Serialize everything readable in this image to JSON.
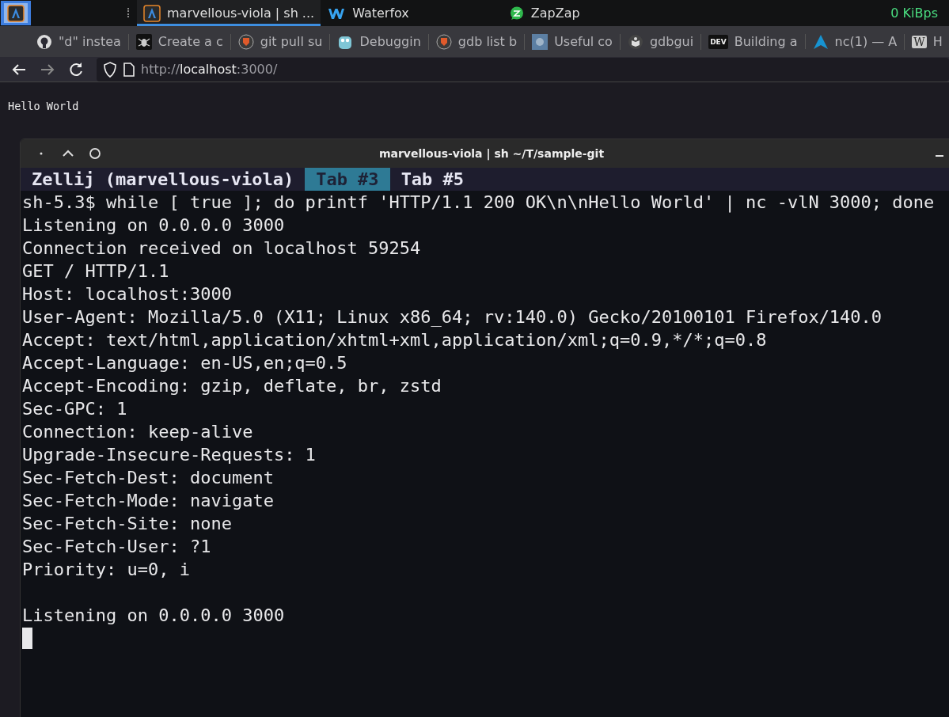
{
  "taskbar": {
    "tasks": [
      {
        "label": "marvellous-viola | sh ...",
        "selected": true,
        "kind": "terminal"
      },
      {
        "label": "Waterfox",
        "selected": false,
        "kind": "waterfox"
      },
      {
        "label": "ZapZap",
        "selected": false,
        "kind": "chat"
      }
    ],
    "network": "0 KiBps"
  },
  "bookmarks": [
    {
      "label": "\"d\" instea",
      "kind": "github"
    },
    {
      "label": "Create a c",
      "kind": "bug"
    },
    {
      "label": "git pull su",
      "kind": "shield"
    },
    {
      "label": "Debuggin",
      "kind": "gopher"
    },
    {
      "label": "gdb list b",
      "kind": "shield"
    },
    {
      "label": "Useful co",
      "kind": "image"
    },
    {
      "label": "gdbgui",
      "kind": "book"
    },
    {
      "label": "Building a",
      "kind": "dev"
    },
    {
      "label": "nc(1) — A",
      "kind": "arch"
    },
    {
      "label": "H",
      "kind": "wiki"
    }
  ],
  "dev_badge": "DEV",
  "wiki_badge": "W",
  "address": {
    "scheme": "http://",
    "host": "localhost",
    "rest": ":3000/"
  },
  "page_text": "Hello World",
  "terminal": {
    "title": "marvellous-viola | sh ~/T/sample-git",
    "session": "Zellij (marvellous-viola)",
    "tabs": [
      {
        "label": "Tab #3",
        "selected": true
      },
      {
        "label": "Tab #5",
        "selected": false
      }
    ],
    "blocks": [
      {
        "lines": [
          "sh-5.3$ while [ true ]; do printf 'HTTP/1.1 200 OK\\n\\nHello World' | nc -vlN 3000; done",
          "Listening on 0.0.0.0 3000",
          "Connection received on localhost 59254",
          "GET / HTTP/1.1",
          "Host: localhost:3000",
          "User-Agent: Mozilla/5.0 (X11; Linux x86_64; rv:140.0) Gecko/20100101 Firefox/140.0",
          "Accept: text/html,application/xhtml+xml,application/xml;q=0.9,*/*;q=0.8",
          "Accept-Language: en-US,en;q=0.5",
          "Accept-Encoding: gzip, deflate, br, zstd",
          "Sec-GPC: 1",
          "Connection: keep-alive",
          "Upgrade-Insecure-Requests: 1",
          "Sec-Fetch-Dest: document",
          "Sec-Fetch-Mode: navigate",
          "Sec-Fetch-Site: none",
          "Sec-Fetch-User: ?1",
          "Priority: u=0, i"
        ]
      },
      {
        "lines": [
          "Listening on 0.0.0.0 3000"
        ]
      }
    ]
  }
}
